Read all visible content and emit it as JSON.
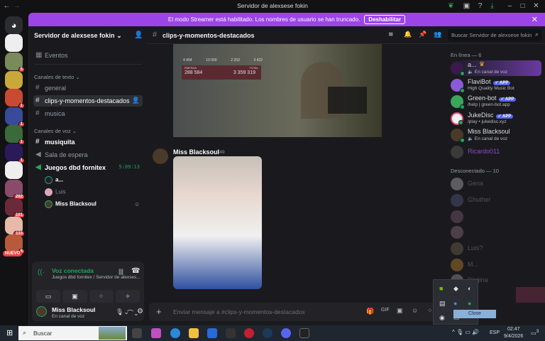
{
  "window": {
    "title": "Servidor de alexsese fokin"
  },
  "banner": {
    "message": "El modo Streamer está habilitado. Los nombres de usuario se han truncado.",
    "button": "Deshabilitar"
  },
  "rail": {
    "badges": [
      "5",
      "1",
      "1",
      "1",
      "1",
      "1",
      "202",
      "101",
      "133",
      "8"
    ],
    "new_label": "NUEVO"
  },
  "sidebar": {
    "server_name": "Servidor de alexsese fokin",
    "events": "Eventos",
    "text_category": "Canales de texto",
    "text_channels": [
      "general",
      "clips-y-momentos-destacados",
      "musica"
    ],
    "voice_category": "Canales de voz",
    "voice_channels": [
      "musiquita",
      "Sala de espera",
      "Juegos dbd fornitex"
    ],
    "voice_timer": "5:09:13",
    "voice_users": [
      "a...",
      "Luis",
      "Miss Blacksoul"
    ]
  },
  "voice_panel": {
    "status": "Voz conectada",
    "location": "Juegos dbd fornitex / Servidor de alexses..."
  },
  "user_panel": {
    "name": "Miss Blacksoul",
    "status": "En canal de voz"
  },
  "header": {
    "channel": "clips-y-momentos-destacados",
    "search_placeholder": "Buscar Servidor de alexsese fokin"
  },
  "game_stats": {
    "values": [
      "4 404",
      "10 000",
      "2 203",
      "3 422"
    ],
    "match_label": "PARTIDA",
    "match_score": "288 584",
    "total_label": "TOTAL",
    "total_score": "3 359 319"
  },
  "messages": [
    {
      "author": "Miss Blacksoul",
      "time": "1:49"
    }
  ],
  "composer": {
    "placeholder": "Enviar mensaje a #clips-y-momentos-destacados"
  },
  "members": {
    "online_header": "En línea — 6",
    "online": [
      {
        "name": "a...",
        "status": "En canal de voz"
      },
      {
        "name": "FlaviBot",
        "status": "High Quality Music Bot",
        "tag": "APP"
      },
      {
        "name": "Green-bot",
        "status": "/help | green-bot.app",
        "tag": "APP"
      },
      {
        "name": "JukeDisc",
        "status": "/play • jukedisc.xyz",
        "tag": "APP"
      },
      {
        "name": "Miss Blacksoul",
        "status": "En canal de voz"
      },
      {
        "name": "Ricardo011",
        "status": ""
      }
    ],
    "offline_header": "Desconectado — 10",
    "offline": [
      "Gena",
      "Ghuther",
      "",
      "",
      "Luis?",
      "M...",
      "Dirgina"
    ]
  },
  "tray_popup": {
    "tooltip": "Close"
  },
  "taskbar": {
    "search": "Buscar",
    "lang": "ESP",
    "time": "02:47",
    "date": "9/4/2026",
    "notif": "3"
  }
}
